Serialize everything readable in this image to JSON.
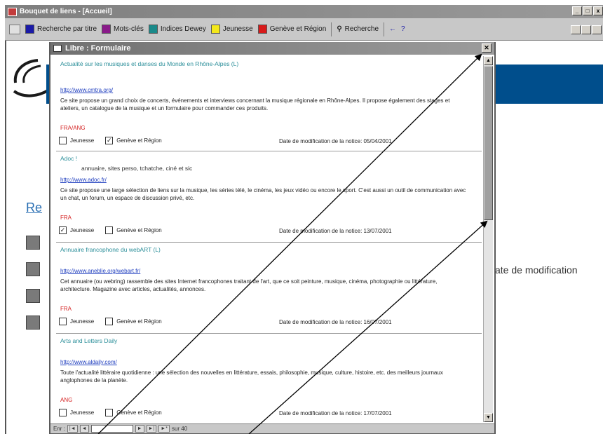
{
  "app": {
    "title": "Bouquet de liens - [Accueil]",
    "toolbar": [
      {
        "label": "Recherche par titre",
        "color": "#1a1aa8"
      },
      {
        "label": "Mots-clés",
        "color": "#8a1a8a"
      },
      {
        "label": "Indices Dewey",
        "color": "#1a8a8a"
      },
      {
        "label": "Jeunesse",
        "color": "#f4e81a"
      },
      {
        "label": "Genève et Région",
        "color": "#d81a1a"
      }
    ],
    "search_label": "Recherche"
  },
  "background": {
    "heading": "Re",
    "date_label": "ate de modification"
  },
  "modal": {
    "title": "Libre : Formulaire",
    "close_symbol": "✕",
    "records": [
      {
        "title": "Actualité sur les musiques et danses du Monde en Rhône-Alpes (L)",
        "subtitle": "",
        "url": "http://www.cmtra.org/",
        "description": "Ce site propose un grand choix de concerts, événements et interviews concernant la musique régionale en Rhône-Alpes. Il propose également des stages et ateliers, un catalogue de la musique et un formulaire pour commander ces produits.",
        "language": "FRA/ANG",
        "jeunesse": false,
        "geneve": true,
        "date": "05/04/2001"
      },
      {
        "title": "Adoc !",
        "subtitle": "annuaire, sites perso, tchatche, ciné et sic",
        "url": "http://www.adoc.fr/",
        "description": "Ce site propose une large sélection de liens sur la musique, les séries télé, le cinéma, les jeux vidéo ou encore le sport. C'est aussi un outil de communication avec un chat, un forum, un espace de discussion privé, etc.",
        "language": "FRA",
        "jeunesse": true,
        "geneve": false,
        "date": "13/07/2001"
      },
      {
        "title": "Annuaire francophone du webART (L)",
        "subtitle": "",
        "url": "http://www.aneblie.org/webart.fr/",
        "description": "Cet annuaire (ou webring) rassemble des sites Internet francophones traitant de l'art, que ce soit peinture, musique, cinéma, photographie ou littérature, architecture. Magazine avec articles, actualités, annonces.",
        "language": "FRA",
        "jeunesse": false,
        "geneve": false,
        "date": "16/07/2001"
      },
      {
        "title": "Arts and Letters Daily",
        "subtitle": "",
        "url": "http://www.aldaily.com/",
        "description": "Toute l'actualité littéraire quotidienne : une sélection des nouvelles en littérature, essais, philosophie, musique, culture, histoire, etc. des meilleurs journaux anglophones de la planète.",
        "language": "ANG",
        "jeunesse": false,
        "geneve": false,
        "date": "17/07/2001"
      }
    ],
    "check_jeunesse": "Jeunesse",
    "check_geneve": "Genève et Région",
    "date_label": "Date de modification de la notice:",
    "nav": {
      "label": "Enr :",
      "count": "sur 40"
    }
  }
}
